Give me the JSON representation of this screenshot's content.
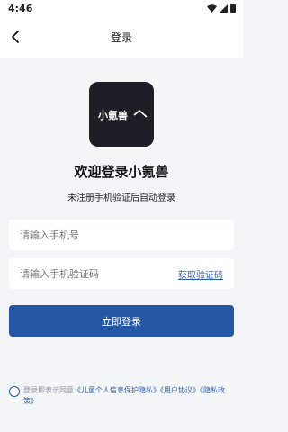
{
  "status_bar": {
    "time": "4:46",
    "icons": [
      "wifi-icon",
      "signal-icon",
      "battery-icon"
    ]
  },
  "nav": {
    "back_icon": "chevron-left-icon",
    "title": "登录"
  },
  "logo": {
    "text": "小氪兽"
  },
  "welcome": {
    "title": "欢迎登录小氪兽",
    "subtitle": "未注册手机验证后自动登录"
  },
  "form": {
    "phone_placeholder": "请输入手机号",
    "phone_value": "",
    "code_placeholder": "请输入手机验证码",
    "code_value": "",
    "get_code_label": "获取验证码",
    "login_label": "立即登录"
  },
  "agreement": {
    "prefix": "登录即表示同意",
    "link_child_privacy": "《儿童个人信息保护隐私》",
    "link_user_agreement": "《用户协议》",
    "link_privacy": "《隐私政策》"
  },
  "colors": {
    "accent": "#2457a6",
    "background": "#f4f5f7",
    "logo_bg": "#1e1f26"
  }
}
